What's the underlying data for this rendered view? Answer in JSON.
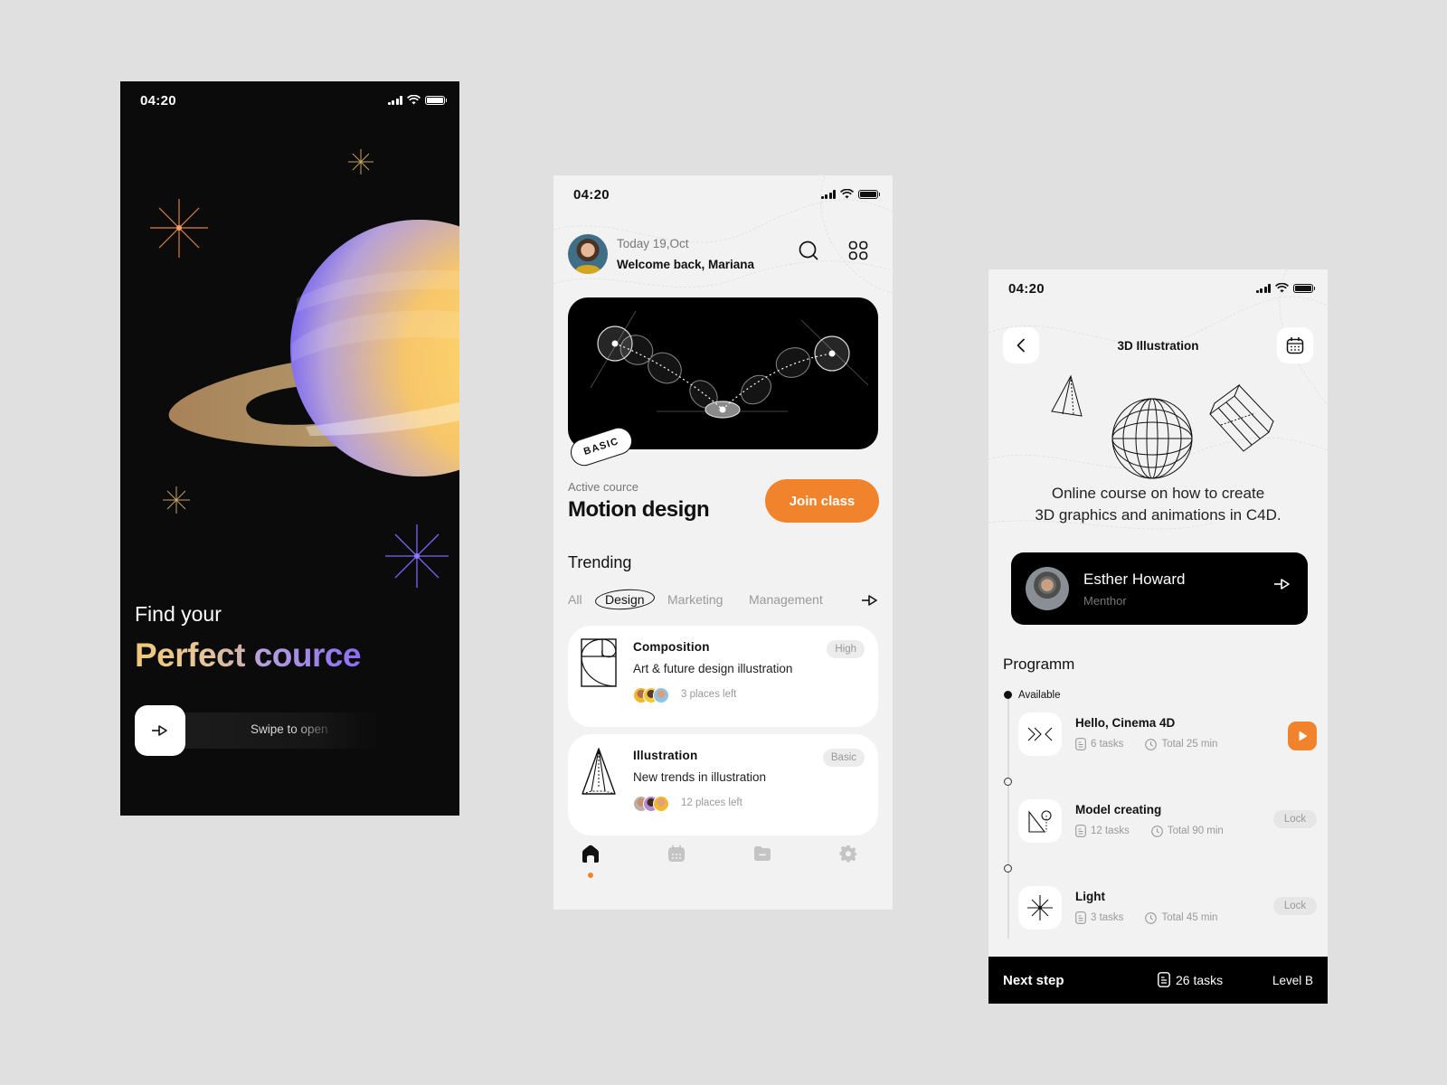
{
  "status_bar": {
    "time": "04:20"
  },
  "onboarding": {
    "headline_small": "Find your",
    "headline_word1": "Perfect",
    "headline_word2": "cource",
    "swipe_label": "Swipe to open",
    "colors": {
      "gold": "#f0c879",
      "violet": "#8c6cf5",
      "orange_star": "#e58a4a"
    }
  },
  "home": {
    "date": "Today 19,Oct",
    "welcome": "Welcome back, Mariana",
    "hero_badge": "BASIC",
    "active_label": "Active cource",
    "course_title": "Motion design",
    "join_button": "Join class",
    "trending_title": "Trending",
    "tabs": [
      {
        "label": "All",
        "active": false
      },
      {
        "label": "Design",
        "active": true
      },
      {
        "label": "Marketing",
        "active": false
      },
      {
        "label": "Management",
        "active": false
      }
    ],
    "cards": [
      {
        "title": "Composition",
        "subtitle": "Art & future design illustration",
        "level": "High",
        "places": "3 places left",
        "icon": "golden-ratio-icon"
      },
      {
        "title": "Illustration",
        "subtitle": "New trends in illustration",
        "level": "Basic",
        "places": "12 places left",
        "icon": "pyramid-icon"
      }
    ],
    "nav": [
      {
        "name": "home",
        "active": true
      },
      {
        "name": "calendar",
        "active": false
      },
      {
        "name": "folder",
        "active": false
      },
      {
        "name": "settings",
        "active": false
      }
    ],
    "accent": "#f2832d"
  },
  "course": {
    "title": "3D Illustration",
    "description_line1": "Online course on how to create",
    "description_line2": "3D graphics and animations in C4D.",
    "mentor": {
      "name": "Esther Howard",
      "role": "Menthor"
    },
    "programm_title": "Programm",
    "available_label": "Available",
    "lessons": [
      {
        "name": "Hello, Cinema 4D",
        "tasks": "6 tasks",
        "duration": "Total 25 min",
        "state": "play"
      },
      {
        "name": "Model creating",
        "tasks": "12 tasks",
        "duration": "Total 90 min",
        "state": "Lock"
      },
      {
        "name": "Light",
        "tasks": "3 tasks",
        "duration": "Total 45 min",
        "state": "Lock"
      }
    ],
    "footer": {
      "label": "Next step",
      "tasks": "26 tasks",
      "level": "Level B"
    }
  }
}
